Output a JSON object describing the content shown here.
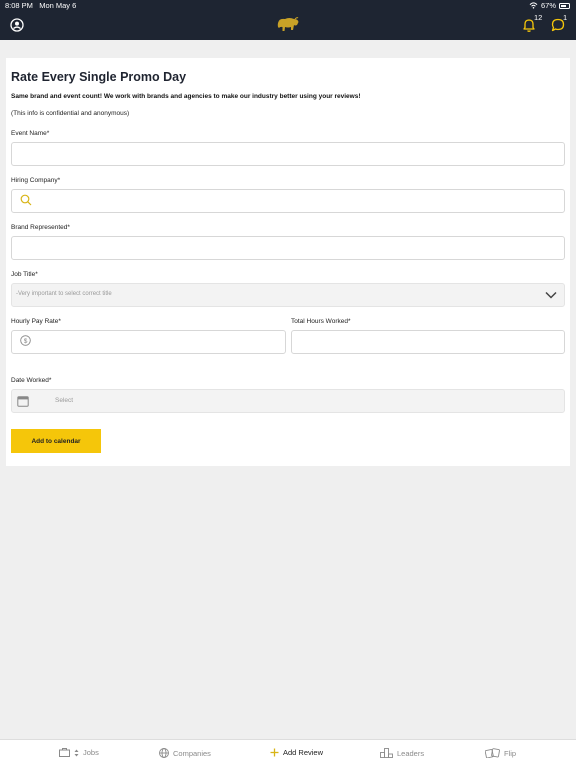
{
  "status_bar": {
    "time": "8:08 PM",
    "date": "Mon May 6",
    "battery": "67%"
  },
  "header": {
    "notifications_count": "12",
    "messages_count": "1"
  },
  "form": {
    "title": "Rate Every Single Promo Day",
    "subtitle": "Same brand and event count! We work with brands and agencies to make our industry better using your reviews!",
    "note": "(This info is confidential and anonymous)",
    "event_name_label": "Event Name*",
    "event_name_value": "",
    "hiring_company_label": "Hiring Company*",
    "hiring_company_value": "",
    "brand_label": "Brand Represented*",
    "brand_value": "",
    "job_title_label": "Job Title*",
    "job_title_placeholder": "-Very important to select correct title",
    "pay_rate_label": "Hourly Pay Rate*",
    "pay_rate_value": "",
    "hours_label": "Total Hours Worked*",
    "hours_value": "",
    "date_label": "Date Worked*",
    "date_placeholder": "Select",
    "add_calendar_label": "Add to calendar"
  },
  "tabs": [
    {
      "label": "Jobs",
      "icon": "briefcase-icon"
    },
    {
      "label": "Companies",
      "icon": "globe-icon"
    },
    {
      "label": "Add Review",
      "icon": "plus-icon"
    },
    {
      "label": "Leaders",
      "icon": "podium-icon"
    },
    {
      "label": "Flip",
      "icon": "flip-icon"
    }
  ],
  "colors": {
    "header_bg": "#1e2532",
    "accent": "#f5c60a",
    "page_bg": "#efefef"
  }
}
